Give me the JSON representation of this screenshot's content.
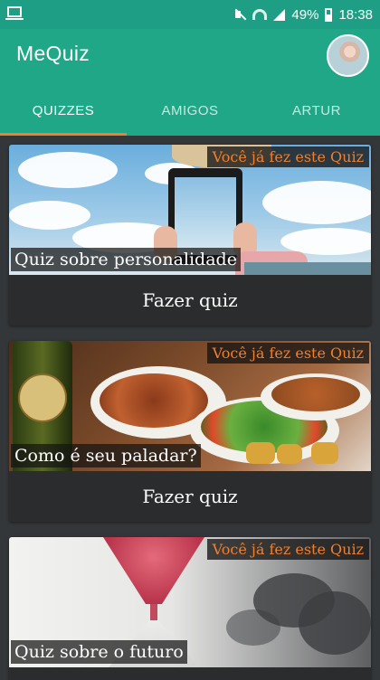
{
  "status_bar": {
    "battery": "49%",
    "time": "18:38"
  },
  "app": {
    "title": "MeQuiz"
  },
  "tabs": [
    {
      "label": "QUIZZES",
      "active": true
    },
    {
      "label": "AMIGOS",
      "active": false
    },
    {
      "label": "ARTUR",
      "active": false
    }
  ],
  "colors": {
    "primary": "#1fa788",
    "accent": "#f07f2e",
    "background": "#34373a",
    "card": "#2b2c2d"
  },
  "quizzes": [
    {
      "title": "Quiz sobre personalidade",
      "badge": "Você já fez este Quiz",
      "action": "Fazer quiz"
    },
    {
      "title": "Como é seu paladar?",
      "badge": "Você já fez este Quiz",
      "action": "Fazer quiz"
    },
    {
      "title": "Quiz sobre o futuro",
      "badge": "Você já fez este Quiz",
      "action": ""
    }
  ]
}
